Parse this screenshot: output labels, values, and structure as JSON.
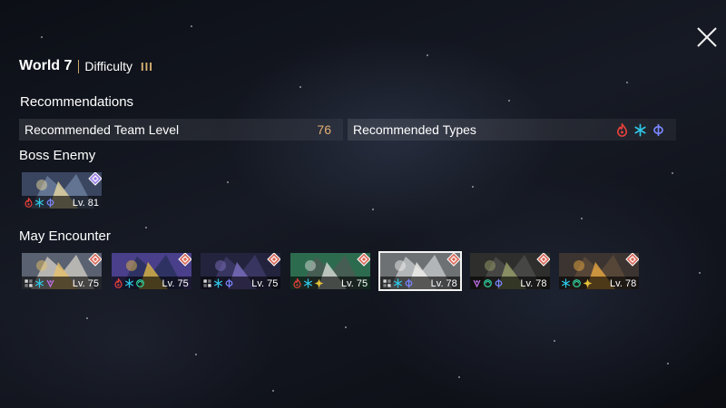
{
  "header": {
    "world": "World 7",
    "difficulty_label": "Difficulty",
    "difficulty_level": "III"
  },
  "recommendations": {
    "title": "Recommendations",
    "team_level_label": "Recommended Team Level",
    "team_level_value": "76",
    "types_label": "Recommended Types",
    "types": [
      "fire-icon",
      "ice-icon",
      "psi-icon"
    ]
  },
  "boss": {
    "title": "Boss Enemy",
    "enemies": [
      {
        "level": "Lv. 81",
        "badge": "diamond-badge-icon",
        "types": [
          "fire-icon",
          "ice-icon",
          "psi-icon"
        ],
        "badge_color": "#9b7fe6"
      }
    ]
  },
  "encounter": {
    "title": "May Encounter",
    "enemies": [
      {
        "level": "Lv. 75",
        "badge": "diamond-badge-icon",
        "types": [
          "physical-icon",
          "ice-icon",
          "poison-icon"
        ],
        "selected": false
      },
      {
        "level": "Lv. 75",
        "badge": "diamond-badge-icon",
        "types": [
          "fire-icon",
          "ice-icon",
          "wind-icon"
        ],
        "selected": false
      },
      {
        "level": "Lv. 75",
        "badge": "diamond-badge-icon",
        "types": [
          "physical-icon",
          "ice-icon",
          "psi-icon"
        ],
        "selected": false
      },
      {
        "level": "Lv. 75",
        "badge": "diamond-badge-icon",
        "types": [
          "fire-icon",
          "ice-icon",
          "light-icon"
        ],
        "selected": false
      },
      {
        "level": "Lv. 78",
        "badge": "diamond-badge-icon",
        "types": [
          "physical-icon",
          "ice-icon",
          "psi-icon"
        ],
        "selected": true
      },
      {
        "level": "Lv. 78",
        "badge": "diamond-badge-icon",
        "types": [
          "poison-icon",
          "wind-icon",
          "psi-icon"
        ],
        "selected": false
      },
      {
        "level": "Lv. 78",
        "badge": "diamond-badge-icon",
        "types": [
          "ice-icon",
          "wind-icon",
          "light-icon"
        ],
        "selected": false
      }
    ]
  },
  "colors": {
    "fire": "#e2403a",
    "ice": "#2fc7e6",
    "psi": "#7a86ff",
    "poison": "#c070e8",
    "wind": "#2ed4a0",
    "light": "#e6c13a",
    "physical": "#d8d8d8",
    "badge": "#d96a5a",
    "accent": "#d8b070"
  }
}
